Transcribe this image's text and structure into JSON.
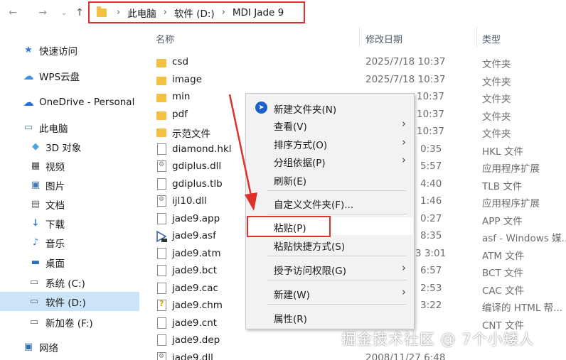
{
  "address": {
    "crumbs": [
      "此电脑",
      "软件 (D:)",
      "MDI Jade 9"
    ]
  },
  "nav": {
    "back": "←",
    "forward": "→",
    "recent": "⌄",
    "up": "↑"
  },
  "sidebar": {
    "items": [
      {
        "label": "快速访问",
        "icon": "star-icon"
      },
      {
        "label": "WPS云盘",
        "icon": "cloud-icon"
      },
      {
        "label": "OneDrive - Personal",
        "icon": "onedrive-icon"
      },
      {
        "label": "此电脑",
        "icon": "pc-icon"
      },
      {
        "label": "3D 对象",
        "icon": "cube-icon"
      },
      {
        "label": "视频",
        "icon": "video-icon"
      },
      {
        "label": "图片",
        "icon": "picture-icon"
      },
      {
        "label": "文档",
        "icon": "document-icon"
      },
      {
        "label": "下载",
        "icon": "download-icon"
      },
      {
        "label": "音乐",
        "icon": "music-icon"
      },
      {
        "label": "桌面",
        "icon": "desktop-icon"
      },
      {
        "label": "系统 (C:)",
        "icon": "drive-c-icon"
      },
      {
        "label": "软件 (D:)",
        "icon": "drive-d-icon"
      },
      {
        "label": "新加卷 (F:)",
        "icon": "drive-f-icon"
      },
      {
        "label": "网络",
        "icon": "network-icon"
      }
    ]
  },
  "columns": {
    "name": "名称",
    "modified": "修改日期",
    "type": "类型"
  },
  "files": [
    {
      "name": "csd",
      "date": "2025/7/18 10:37",
      "type": "文件夹",
      "icon": "folder-icon"
    },
    {
      "name": "image",
      "date": "2025/7/18 10:37",
      "type": "文件夹",
      "icon": "folder-icon"
    },
    {
      "name": "min",
      "date": "10:37",
      "type": "文件夹",
      "icon": "folder-icon"
    },
    {
      "name": "pdf",
      "date": "10:37",
      "type": "文件夹",
      "icon": "folder-icon"
    },
    {
      "name": "示范文件",
      "date": "10:37",
      "type": "文件夹",
      "icon": "folder-icon"
    },
    {
      "name": "diamond.hkl",
      "date": "0:35",
      "type": "HKL 文件",
      "icon": "file-icon"
    },
    {
      "name": "gdiplus.dll",
      "date": "5:57",
      "type": "应用程序扩展",
      "icon": "dll-icon"
    },
    {
      "name": "gdiplus.tlb",
      "date": "4:40",
      "type": "TLB 文件",
      "icon": "file-icon"
    },
    {
      "name": "ijl10.dll",
      "date": "1:46",
      "type": "应用程序扩展",
      "icon": "dll-icon"
    },
    {
      "name": "jade9.app",
      "date": "0:27",
      "type": "APP 文件",
      "icon": "file-icon"
    },
    {
      "name": "jade9.asf",
      "date": "8:35",
      "type": "asf - Windows 媒...",
      "icon": "media-icon"
    },
    {
      "name": "jade9.atm",
      "date": "3 3:01",
      "type": "ATM 文件",
      "icon": "file-icon"
    },
    {
      "name": "jade9.bct",
      "date": "6:57",
      "type": "BCT 文件",
      "icon": "file-icon"
    },
    {
      "name": "jade9.cac",
      "date": "2:53",
      "type": "CAC 文件",
      "icon": "file-icon"
    },
    {
      "name": "jade9.chm",
      "date": "3:22",
      "type": "编译的 HTML 帮...",
      "icon": "chm-icon"
    },
    {
      "name": "jade9.cnt",
      "date": "",
      "type": "CNT 文件",
      "icon": "file-icon"
    },
    {
      "name": "jade9.dep",
      "date": "",
      "type": "",
      "icon": "file-icon"
    },
    {
      "name": "jade9.dll",
      "date": "2008/11/27 6:48",
      "type": "",
      "icon": "dll-icon"
    }
  ],
  "menu": {
    "items": [
      {
        "label": "新建文件夹(N)",
        "submenu": false
      },
      {
        "label": "查看(V)",
        "submenu": true
      },
      {
        "label": "排序方式(O)",
        "submenu": true
      },
      {
        "label": "分组依据(P)",
        "submenu": true
      },
      {
        "label": "刷新(E)",
        "submenu": false
      },
      {
        "label": "自定义文件夹(F)...",
        "submenu": false
      },
      {
        "label": "粘贴(P)",
        "submenu": false
      },
      {
        "label": "粘贴快捷方式(S)",
        "submenu": false
      },
      {
        "label": "授予访问权限(G)",
        "submenu": true
      },
      {
        "label": "新建(W)",
        "submenu": true
      },
      {
        "label": "属性(R)",
        "submenu": false
      }
    ],
    "submenu_arrow": "›"
  },
  "watermark": "掘金技术社区 @ 7个小矮人",
  "colors": {
    "highlight": "#e0302c",
    "selected": "#cce4f7",
    "folder": "#f2c043"
  }
}
